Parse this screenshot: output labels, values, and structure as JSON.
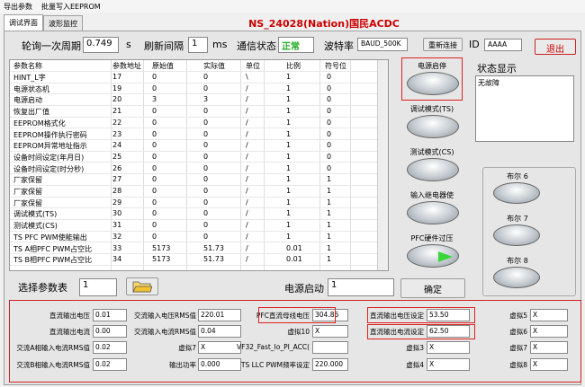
{
  "menu": {
    "export_params": "导出参数",
    "batch_write": "批量写入EEPROM"
  },
  "tabs": [
    {
      "label": "调试界面"
    },
    {
      "label": "波形监控"
    }
  ],
  "app_title": "NS_24028(Nation)国民ACDC",
  "top": {
    "poll_label": "轮询一次周期",
    "poll_value": "0.749",
    "poll_unit": "s",
    "refresh_label": "刷新间隔",
    "refresh_value": "1",
    "refresh_unit": "ms",
    "comm_label": "通信状态",
    "comm_status": "正常",
    "baud_label": "波特率",
    "baud_value": "BAUD_500K",
    "reconnect": "重新连接",
    "id_label": "ID",
    "id_value": "AAAA",
    "exit": "退出"
  },
  "table": {
    "headers": [
      "参数名称",
      "参数地址",
      "原始值",
      "实际值",
      "单位",
      "比例",
      "符号位"
    ],
    "rows": [
      [
        "HINT_L字",
        "17",
        "0",
        "0",
        "\\",
        "1",
        "0"
      ],
      [
        "电源状态机",
        "19",
        "0",
        "0",
        "/",
        "1",
        "0"
      ],
      [
        "电源启动",
        "20",
        "3",
        "3",
        "/",
        "1",
        "0"
      ],
      [
        "恢复出厂值",
        "21",
        "0",
        "0",
        "/",
        "1",
        "0"
      ],
      [
        "EEPROM格式化",
        "22",
        "0",
        "0",
        "/",
        "1",
        "0"
      ],
      [
        "EEPROM操作执行密码",
        "23",
        "0",
        "0",
        "/",
        "1",
        "0"
      ],
      [
        "EEPROM异常地址指示",
        "24",
        "0",
        "0",
        "/",
        "1",
        "0"
      ],
      [
        "设备时间设定(年月日)",
        "25",
        "0",
        "0",
        "/",
        "1",
        "0"
      ],
      [
        "设备时间设定(时分秒)",
        "26",
        "0",
        "0",
        "/",
        "1",
        "0"
      ],
      [
        "厂家保留",
        "27",
        "0",
        "0",
        "/",
        "1",
        "1"
      ],
      [
        "厂家保留",
        "28",
        "0",
        "0",
        "/",
        "1",
        "1"
      ],
      [
        "厂家保留",
        "29",
        "0",
        "0",
        "/",
        "1",
        "1"
      ],
      [
        "调试模式(TS)",
        "30",
        "0",
        "0",
        "/",
        "1",
        "1"
      ],
      [
        "测试模式(CS)",
        "31",
        "0",
        "0",
        "/",
        "1",
        "1"
      ],
      [
        "TS PFC PWM使能输出",
        "32",
        "0",
        "0",
        "/",
        "1",
        "1"
      ],
      [
        "TS A相PFC PWM占空比",
        "33",
        "5173",
        "51.73",
        "/",
        "0.01",
        "1"
      ],
      [
        "TS B相PFC PWM占空比",
        "34",
        "5173",
        "51.73",
        "/",
        "0.01",
        "1"
      ]
    ]
  },
  "select_table": {
    "label": "选择参数表",
    "value": "1"
  },
  "power_start": {
    "label": "电源启动",
    "value": "1",
    "confirm": "确定"
  },
  "toggles": [
    {
      "label": "电源启停"
    },
    {
      "label": "调试模式(TS)"
    },
    {
      "label": "测试模式(CS)"
    },
    {
      "label": "输入继电器使"
    },
    {
      "label": "PFC硬件过压"
    }
  ],
  "status_panel": {
    "label": "状态显示",
    "text": "无故障"
  },
  "bools": [
    {
      "label": "布尔 6"
    },
    {
      "label": "布尔 7"
    },
    {
      "label": "布尔 8"
    }
  ],
  "bottom": {
    "col1": [
      {
        "label": "直流输出电压",
        "value": "0.01"
      },
      {
        "label": "直流输出电流",
        "value": "0.00"
      },
      {
        "label": "交流A相输入电流RMS值",
        "value": "0.02"
      },
      {
        "label": "交流B相输入电流RMS值",
        "value": "0.02"
      }
    ],
    "col2": [
      {
        "label": "交流输入电压RMS值",
        "value": "220.01"
      },
      {
        "label": "交流输入电流RMS值",
        "value": "0.04"
      },
      {
        "label": "虚拟7",
        "value": "X"
      },
      {
        "label": "输出功率",
        "value": "0.000"
      }
    ],
    "col3": [
      {
        "label": "PFC直流母线电压",
        "value": "304.86"
      },
      {
        "label": "虚拟10",
        "value": "X"
      },
      {
        "label": "VF32_Fast_Io_PI_ACC(",
        "value": ""
      },
      {
        "label": "TS LLC PWM频率设定",
        "value": "220.000"
      }
    ],
    "col4": [
      {
        "label": "直流输出电压设定",
        "value": "53.50"
      },
      {
        "label": "直流输出电流设定",
        "value": "62.50"
      },
      {
        "label": "虚拟3",
        "value": "X"
      },
      {
        "label": "虚拟4",
        "value": "X"
      }
    ],
    "col5": [
      {
        "label": "虚拟5",
        "value": "X"
      },
      {
        "label": "虚拟6",
        "value": "X"
      },
      {
        "label": "虚拟7",
        "value": "X"
      },
      {
        "label": "虚拟8",
        "value": "X"
      }
    ]
  },
  "colors": {
    "accent_red": "#cc0000",
    "status_green": "#22aa22",
    "led_green": "#3bd63b"
  }
}
